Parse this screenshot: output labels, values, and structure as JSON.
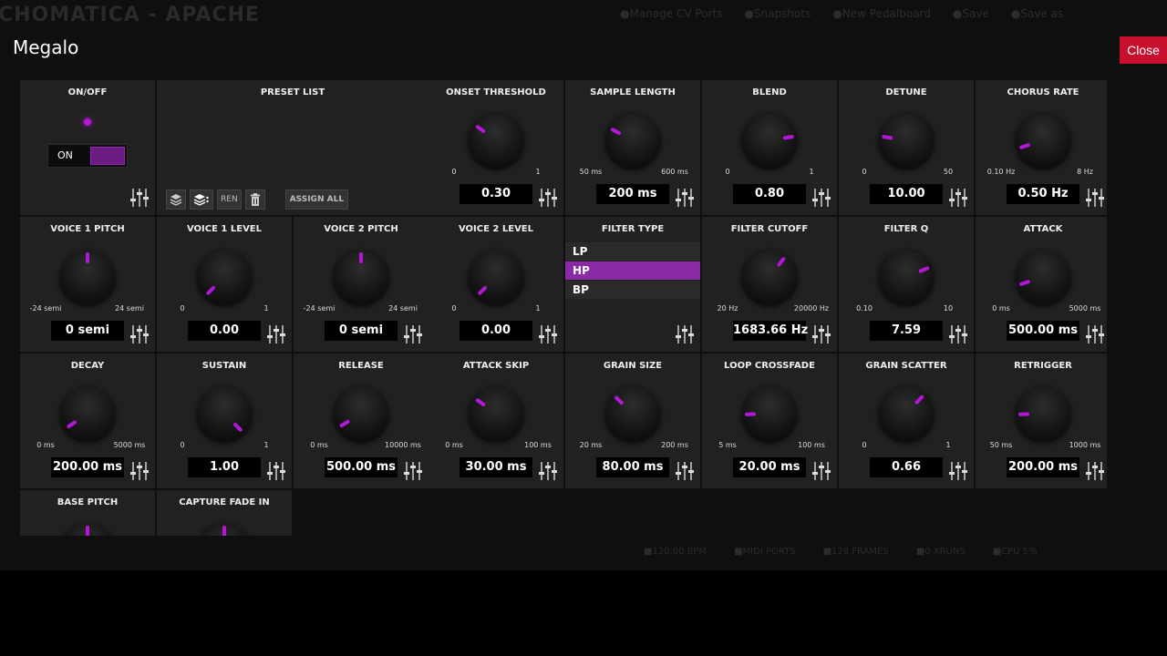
{
  "background": {
    "title": "CHOMATICA - APACHE",
    "top_actions": [
      "Manage CV Ports",
      "Snapshots",
      "New Pedalboard",
      "Save",
      "Save as"
    ],
    "status": [
      "120.00 BPM",
      "MIDI PORTS",
      "128 FRAMES",
      "0 XRUNS",
      "CPU 5%"
    ]
  },
  "dialog": {
    "title": "Megalo",
    "close_label": "Close"
  },
  "colors": {
    "accent": "#b516d9",
    "close": "#c8102e",
    "cell_bg": "#212121"
  },
  "onoff": {
    "label": "ON/OFF",
    "state_label": "ON"
  },
  "preset": {
    "label": "PRESET LIST",
    "rename_label": "REN",
    "assign_all_label": "ASSIGN ALL"
  },
  "filter_type": {
    "label": "FILTER TYPE",
    "options": [
      "LP",
      "HP",
      "BP"
    ],
    "selected": "HP"
  },
  "params": [
    {
      "label": "ONSET THRESHOLD",
      "min": "0",
      "max": "1",
      "value": "0.30",
      "fraction": 0.3
    },
    {
      "label": "SAMPLE LENGTH",
      "min": "50 ms",
      "max": "600 ms",
      "value": "200 ms",
      "fraction": 0.27
    },
    {
      "label": "BLEND",
      "min": "0",
      "max": "1",
      "value": "0.80",
      "fraction": 0.8
    },
    {
      "label": "DETUNE",
      "min": "0",
      "max": "50",
      "value": "10.00",
      "fraction": 0.2
    },
    {
      "label": "CHORUS RATE",
      "min": "0.10 Hz",
      "max": "8 Hz",
      "value": "0.50 Hz",
      "fraction": 0.1
    },
    {
      "label": "VOICE 1 PITCH",
      "min": "-24 semi",
      "max": "24 semi",
      "value": "0 semi",
      "fraction": 0.5
    },
    {
      "label": "VOICE 1 LEVEL",
      "min": "0",
      "max": "1",
      "value": "0.00",
      "fraction": 0.0
    },
    {
      "label": "VOICE 2 PITCH",
      "min": "-24 semi",
      "max": "24 semi",
      "value": "0 semi",
      "fraction": 0.5
    },
    {
      "label": "VOICE 2 LEVEL",
      "min": "0",
      "max": "1",
      "value": "0.00",
      "fraction": 0.0
    },
    {
      "label": "FILTER CUTOFF",
      "min": "20 Hz",
      "max": "20000 Hz",
      "value": "1683.66 Hz",
      "fraction": 0.64
    },
    {
      "label": "FILTER Q",
      "min": "0.10",
      "max": "10",
      "value": "7.59",
      "fraction": 0.75
    },
    {
      "label": "ATTACK",
      "min": "0 ms",
      "max": "5000 ms",
      "value": "500.00 ms",
      "fraction": 0.1
    },
    {
      "label": "DECAY",
      "min": "0 ms",
      "max": "5000 ms",
      "value": "200.00 ms",
      "fraction": 0.04
    },
    {
      "label": "SUSTAIN",
      "min": "0",
      "max": "1",
      "value": "1.00",
      "fraction": 1.0
    },
    {
      "label": "RELEASE",
      "min": "0 ms",
      "max": "10000 ms",
      "value": "500.00 ms",
      "fraction": 0.05
    },
    {
      "label": "ATTACK SKIP",
      "min": "0 ms",
      "max": "100 ms",
      "value": "30.00 ms",
      "fraction": 0.3
    },
    {
      "label": "GRAIN SIZE",
      "min": "20 ms",
      "max": "200 ms",
      "value": "80.00 ms",
      "fraction": 0.33
    },
    {
      "label": "LOOP CROSSFADE",
      "min": "5 ms",
      "max": "100 ms",
      "value": "20.00 ms",
      "fraction": 0.16
    },
    {
      "label": "GRAIN SCATTER",
      "min": "0",
      "max": "1",
      "value": "0.66",
      "fraction": 0.66
    },
    {
      "label": "RETRIGGER",
      "min": "50 ms",
      "max": "1000 ms",
      "value": "200.00 ms",
      "fraction": 0.16
    },
    {
      "label": "BASE PITCH",
      "min": "",
      "max": "",
      "value": "",
      "fraction": 0.5
    },
    {
      "label": "CAPTURE FADE IN",
      "min": "",
      "max": "",
      "value": "",
      "fraction": 0.5
    }
  ]
}
